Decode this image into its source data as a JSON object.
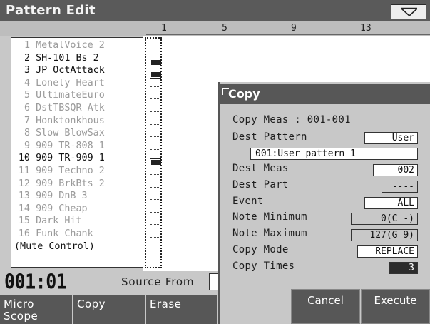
{
  "header": {
    "title": "Pattern Edit",
    "menu_icon": "triangle-down-icon"
  },
  "ruler": {
    "marks": [
      "1",
      "5",
      "9",
      "13"
    ]
  },
  "tracks": [
    {
      "num": "1",
      "name": "MetalVoice 2",
      "active": false,
      "has_data": false
    },
    {
      "num": "2",
      "name": "SH-101 Bs 2",
      "active": true,
      "has_data": true
    },
    {
      "num": "3",
      "name": "JP OctAttack",
      "active": true,
      "has_data": true
    },
    {
      "num": "4",
      "name": "Lonely Heart",
      "active": false,
      "has_data": false
    },
    {
      "num": "5",
      "name": "UltimateEuro",
      "active": false,
      "has_data": false
    },
    {
      "num": "6",
      "name": "DstTBSQR Atk",
      "active": false,
      "has_data": false
    },
    {
      "num": "7",
      "name": "Honktonkhous",
      "active": false,
      "has_data": false
    },
    {
      "num": "8",
      "name": "Slow BlowSax",
      "active": false,
      "has_data": false
    },
    {
      "num": "9",
      "name": "909 TR-808 1",
      "active": false,
      "has_data": false
    },
    {
      "num": "10",
      "name": "909 TR-909 1",
      "active": true,
      "has_data": true
    },
    {
      "num": "11",
      "name": "909 Techno 2",
      "active": false,
      "has_data": false
    },
    {
      "num": "12",
      "name": "909 BrkBts 2",
      "active": false,
      "has_data": false
    },
    {
      "num": "13",
      "name": "909 DnB 3",
      "active": false,
      "has_data": false
    },
    {
      "num": "14",
      "name": "909 Cheap",
      "active": false,
      "has_data": false
    },
    {
      "num": "15",
      "name": "Dark Hit",
      "active": false,
      "has_data": false
    },
    {
      "num": "16",
      "name": "Funk Chank",
      "active": false,
      "has_data": false
    }
  ],
  "mute_control": "(Mute Control)",
  "measure": "001:01",
  "source_from_label": "Source From",
  "function_buttons": [
    "Micro\nScope",
    "Copy",
    "Erase"
  ],
  "copy_dialog": {
    "title": "Copy",
    "copy_meas": "Copy Meas : 001-001",
    "dest_pattern_label": "Dest Pattern",
    "dest_pattern_value": "User",
    "dest_pattern_name": "001:User pattern 1",
    "dest_meas_label": "Dest Meas",
    "dest_meas_value": "002",
    "dest_part_label": "Dest Part",
    "dest_part_value": "----",
    "event_label": "Event",
    "event_value": "ALL",
    "note_min_label": "Note Minimum",
    "note_min_value": "0(C -)",
    "note_max_label": "Note Maximum",
    "note_max_value": "127(G 9)",
    "copy_mode_label": "Copy Mode",
    "copy_mode_value": "REPLACE",
    "copy_times_label": "Copy Times",
    "copy_times_value": "3",
    "cancel_label": "Cancel",
    "execute_label": "Execute"
  }
}
